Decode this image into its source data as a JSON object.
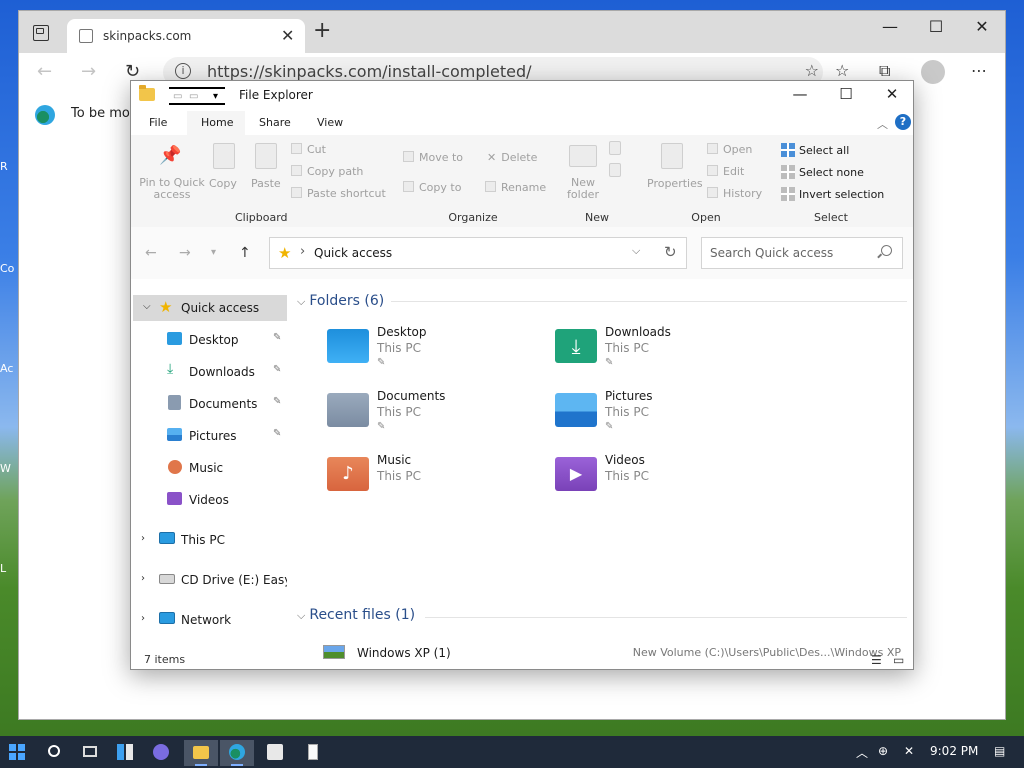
{
  "desktop": {
    "edge_letters": [
      "R",
      "Co",
      "Ac",
      "W",
      "L"
    ]
  },
  "browser": {
    "tab_title": "skinpacks.com",
    "url": "https://skinpacks.com/install-completed/",
    "content_text": "To be mos",
    "icons": [
      "tab-actions-icon",
      "close-icon",
      "plus-icon",
      "back-icon",
      "forward-icon",
      "refresh-icon",
      "info-icon",
      "favorite-add-icon",
      "favorites-icon",
      "collections-icon",
      "profile-icon",
      "more-icon"
    ]
  },
  "explorer": {
    "title": "File Explorer",
    "menu_tabs": [
      "File",
      "Home",
      "Share",
      "View"
    ],
    "active_tab": "Home",
    "ribbon": {
      "clipboard": {
        "group": "Clipboard",
        "pin": "Pin to Quick access",
        "copy": "Copy",
        "paste": "Paste",
        "cut": "Cut",
        "copy_path": "Copy path",
        "paste_shortcut": "Paste shortcut"
      },
      "organize": {
        "group": "Organize",
        "move_to": "Move to",
        "copy_to": "Copy to",
        "delete": "Delete",
        "rename": "Rename"
      },
      "new": {
        "group": "New",
        "new_folder": "New folder"
      },
      "open": {
        "group": "Open",
        "properties": "Properties",
        "open": "Open",
        "edit": "Edit",
        "history": "History"
      },
      "select": {
        "group": "Select",
        "select_all": "Select all",
        "select_none": "Select none",
        "invert": "Invert selection"
      }
    },
    "address": {
      "location": "Quick access",
      "search_placeholder": "Search Quick access"
    },
    "sidebar": {
      "items": [
        {
          "label": "Quick access",
          "icon": "star-icon"
        },
        {
          "label": "Desktop",
          "icon": "desktop-folder-icon"
        },
        {
          "label": "Downloads",
          "icon": "download-icon"
        },
        {
          "label": "Documents",
          "icon": "documents-icon"
        },
        {
          "label": "Pictures",
          "icon": "pictures-icon"
        },
        {
          "label": "Music",
          "icon": "music-icon"
        },
        {
          "label": "Videos",
          "icon": "videos-icon"
        },
        {
          "label": "This PC",
          "icon": "monitor-icon"
        },
        {
          "label": "CD Drive (E:) EasyKM",
          "icon": "cd-drive-icon"
        },
        {
          "label": "Network",
          "icon": "network-icon"
        }
      ]
    },
    "folders": {
      "heading": "Folders (6)",
      "items": [
        {
          "name": "Desktop",
          "location": "This PC",
          "color": "#1e8fdc"
        },
        {
          "name": "Downloads",
          "location": "This PC",
          "color": "#1fa37a"
        },
        {
          "name": "Documents",
          "location": "This PC",
          "color": "#8a9bb0"
        },
        {
          "name": "Pictures",
          "location": "This PC",
          "color": "#2b8fe6"
        },
        {
          "name": "Music",
          "location": "This PC",
          "color": "#e0764a"
        },
        {
          "name": "Videos",
          "location": "This PC",
          "color": "#8a52c8"
        }
      ]
    },
    "recent": {
      "heading": "Recent files (1)",
      "items": [
        {
          "name": "Windows XP (1)",
          "path": "New Volume (C:)\\Users\\Public\\Des...\\Windows XP"
        }
      ]
    },
    "status": "7 items"
  },
  "taskbar": {
    "time": "9:02 PM",
    "apps": [
      "start-icon",
      "search-icon",
      "task-view-icon",
      "widgets-icon",
      "chat-icon",
      "file-explorer-icon",
      "edge-icon",
      "store-icon",
      "notepad-icon"
    ]
  }
}
